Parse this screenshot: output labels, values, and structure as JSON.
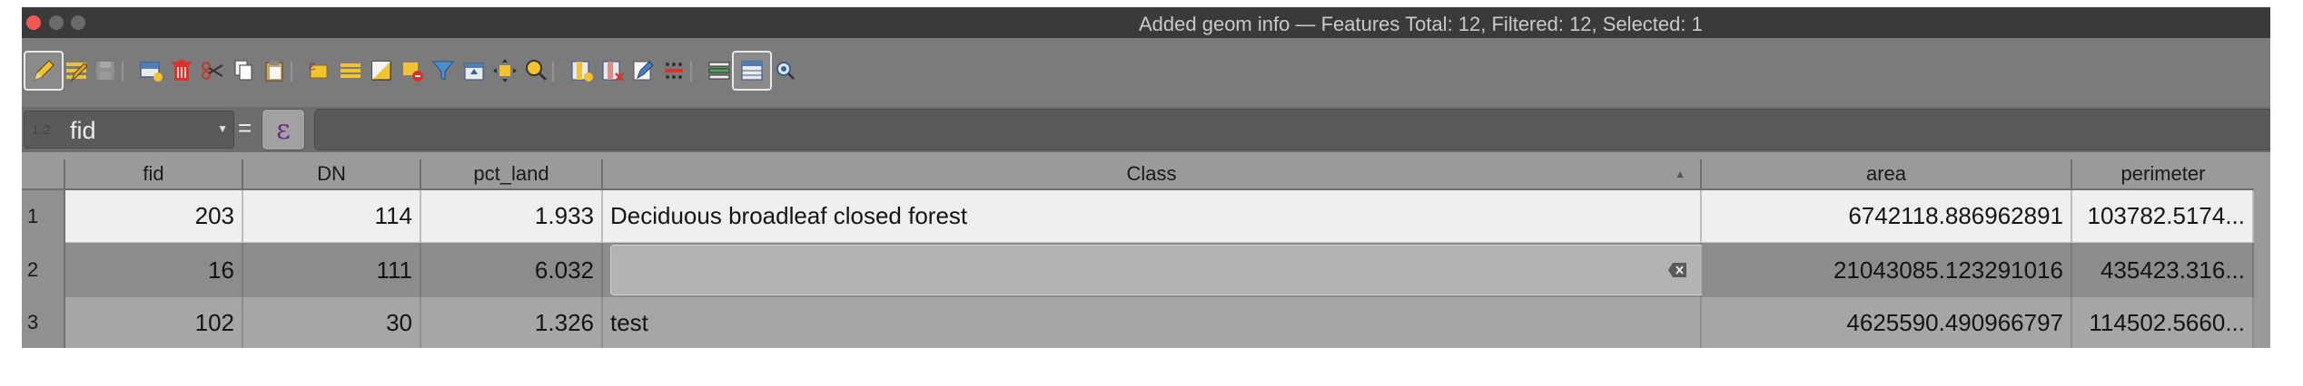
{
  "window": {
    "title": "Added geom info — Features Total: 12, Filtered: 12, Selected: 1"
  },
  "toolbar": {
    "icons": [
      "toggle-editing-icon",
      "multi-edit-icon",
      "save-edits-icon",
      "add-feature-icon",
      "delete-selected-icon",
      "cut-icon",
      "copy-icon",
      "paste-icon",
      "select-by-expression-icon",
      "select-all-icon",
      "invert-selection-icon",
      "deselect-all-icon",
      "filter-select-icon",
      "move-selection-top-icon",
      "pan-to-selection-icon",
      "zoom-to-selection-icon",
      "new-field-icon",
      "delete-field-icon",
      "conditional-formatting-icon",
      "field-calculator-icon",
      "organize-columns-icon",
      "dock-table-icon",
      "actions-icon"
    ]
  },
  "filter": {
    "type_glyph": "1.2",
    "field": "fid",
    "equals": "=",
    "expression_glyph": "ε",
    "value": ""
  },
  "table": {
    "columns": [
      "fid",
      "DN",
      "pct_land",
      "Class",
      "area",
      "perimeter"
    ],
    "sorted_column": "Class",
    "sort_glyph": "▲",
    "rows": [
      {
        "num": "1",
        "fid": "203",
        "DN": "114",
        "pct_land": "1.933",
        "Class": "Deciduous broadleaf closed forest",
        "area": "6742118.886962891",
        "perimeter": "103782.5174..."
      },
      {
        "num": "2",
        "fid": "16",
        "DN": "111",
        "pct_land": "6.032",
        "Class": "",
        "area": "21043085.123291016",
        "perimeter": "435423.316..."
      },
      {
        "num": "3",
        "fid": "102",
        "DN": "30",
        "pct_land": "1.326",
        "Class": "test",
        "area": "4625590.490966797",
        "perimeter": "114502.5660..."
      }
    ]
  },
  "colors": {
    "accent_close": "#ee5a52",
    "selected_row": "#efefef",
    "expression_purple": "#6b2f82"
  }
}
